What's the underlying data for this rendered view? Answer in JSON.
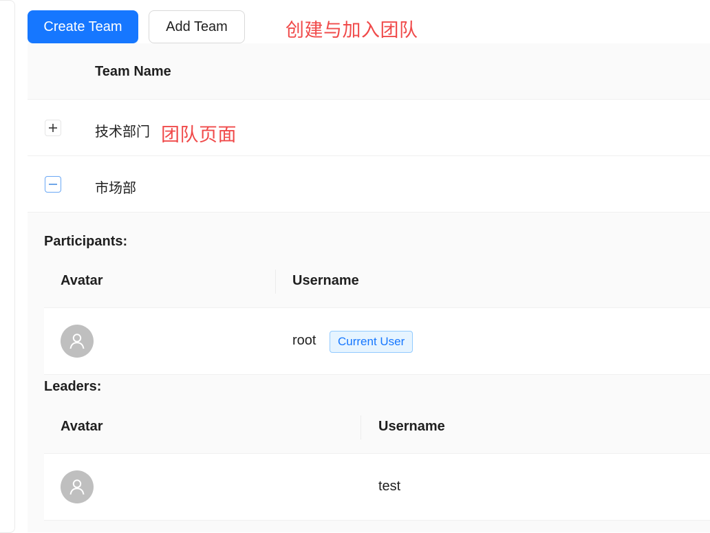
{
  "toolbar": {
    "create_label": "Create Team",
    "add_label": "Add Team",
    "annotation": "创建与加入团队"
  },
  "table": {
    "header_team_name": "Team Name",
    "rows": [
      {
        "name": "技术部门",
        "annotation": "团队页面",
        "expanded": false
      },
      {
        "name": "市场部",
        "expanded": true
      }
    ]
  },
  "expanded_team": {
    "participants_title": "Participants:",
    "participants_columns": {
      "avatar": "Avatar",
      "username": "Username"
    },
    "participants": [
      {
        "username": "root",
        "tag": "Current User",
        "avatar_icon": "user-icon"
      }
    ],
    "leaders_title": "Leaders:",
    "leaders_columns": {
      "avatar": "Avatar",
      "username": "Username"
    },
    "leaders": [
      {
        "username": "test",
        "avatar_icon": "user-icon"
      }
    ]
  },
  "colors": {
    "primary": "#1677ff",
    "annotation": "#f04a4a",
    "avatar_bg": "#bfbfbf",
    "tag_bg": "#e6f4ff"
  }
}
